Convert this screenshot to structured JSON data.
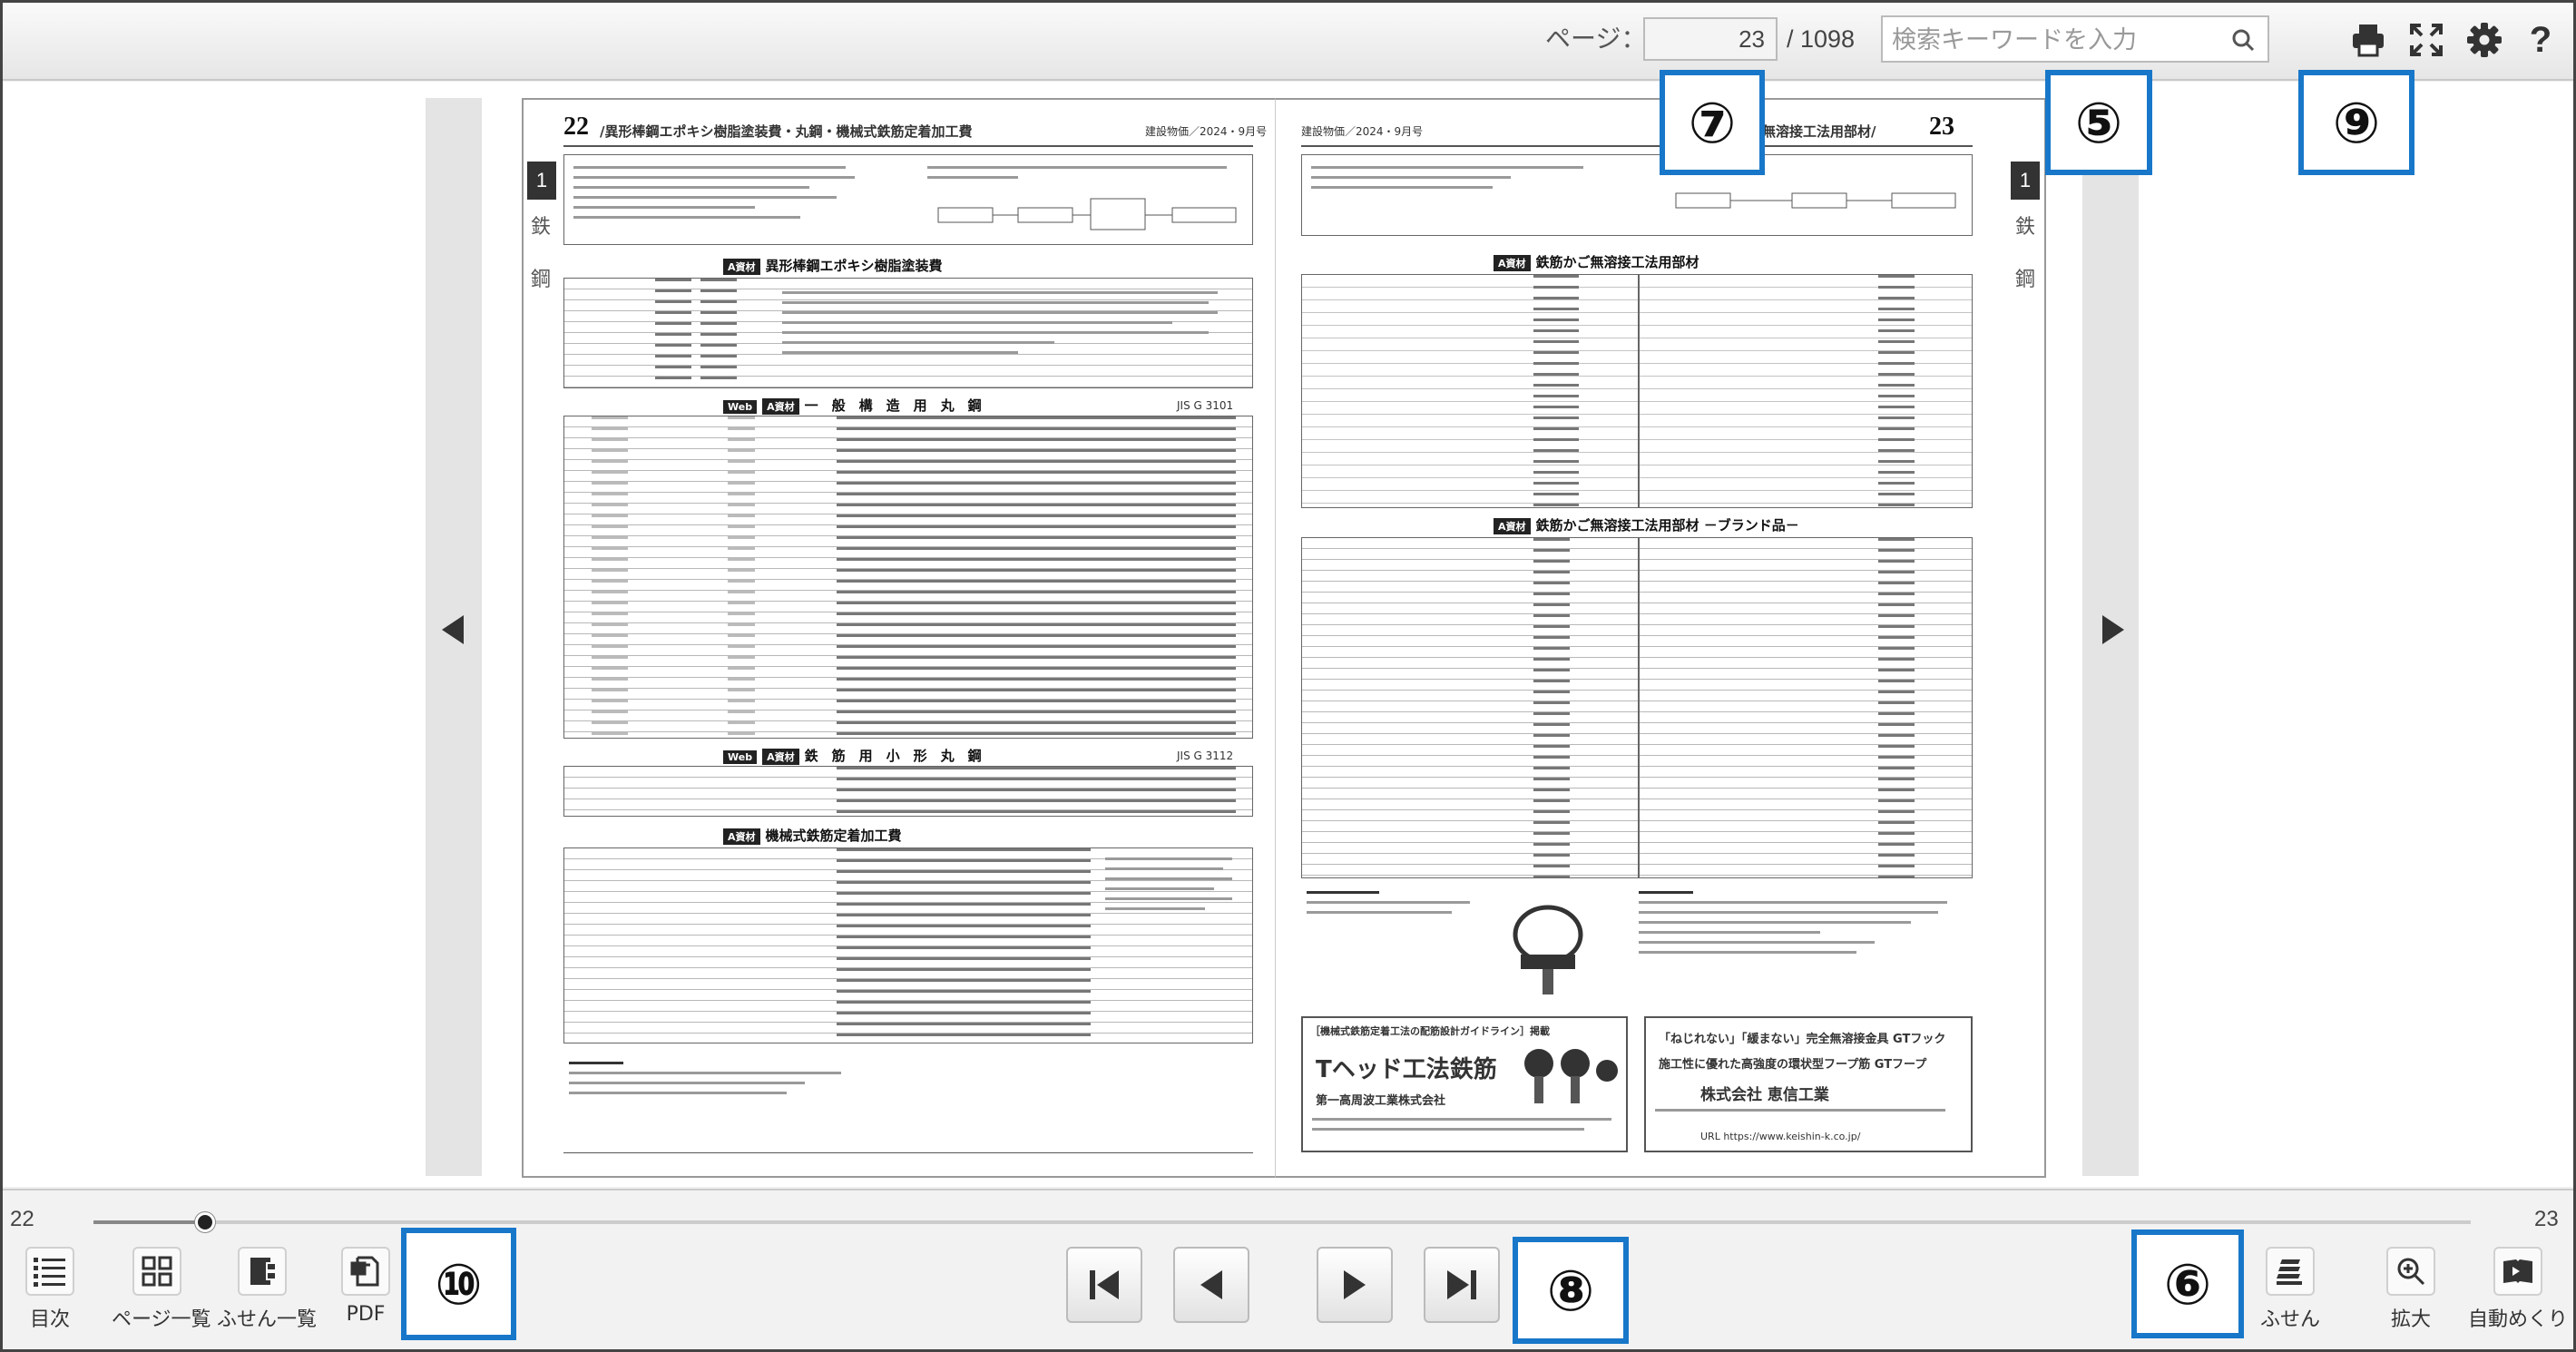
{
  "toolbar": {
    "page_label": "ページ：",
    "current_page": "23",
    "total_pages": "/ 1098",
    "search_placeholder": "検索キーワードを入力",
    "icons": [
      "print-icon",
      "fullscreen-icon",
      "gear-icon",
      "help-icon"
    ]
  },
  "document": {
    "left_page": {
      "page_number": "22",
      "title": "/異形棒鋼エポキシ樹脂塗装費・丸鋼・機械式鉄筋定着加工費",
      "header_right": "建設物価／2024・9月号",
      "section_tab": "1",
      "side_chars": [
        "鉄",
        "鋼"
      ],
      "sections": [
        "異形棒鋼エポキシ樹脂塗装費",
        "一　般　構　造　用　丸　鋼",
        "鉄　筋　用　小　形　丸　鋼",
        "機械式鉄筋定着加工費"
      ],
      "standards": [
        "JIS G 3101",
        "JIS G 3112"
      ],
      "tags": [
        "Web",
        "A資材"
      ]
    },
    "right_page": {
      "page_number": "23",
      "title": "鉄筋かご無溶接工法用部材/",
      "header_left": "建設物価／2024・9月号",
      "section_tab": "1",
      "side_chars": [
        "鉄",
        "鋼"
      ],
      "sections": [
        "鉄筋かご無溶接工法用部材",
        "鉄筋かご無溶接工法用部材 －ブランド品－"
      ],
      "ads": [
        {
          "heading": "［機械式鉄筋定着工法の配筋設計ガイドライン］掲載",
          "name": "Tヘッド工法鉄筋",
          "company": "第一高周波工業株式会社"
        },
        {
          "heading": "「ねじれない」「緩まない」完全無溶接金具 GTフック",
          "name": "施工性に優れた高強度の環状型フープ筋 GTフープ",
          "company": "株式会社 恵信工業",
          "url": "URL https://www.keishin-k.co.jp/"
        }
      ]
    }
  },
  "slider": {
    "min_label": "22",
    "max_label": "23",
    "position": 0.047
  },
  "bottom_tools_left": [
    {
      "label": "目次",
      "icon": "toc-icon"
    },
    {
      "label": "ページ一覧",
      "icon": "grid-icon"
    },
    {
      "label": "ふせん一覧",
      "icon": "sticky-list-icon"
    },
    {
      "label": "PDF",
      "icon": "pdf-icon"
    }
  ],
  "bottom_tools_right": [
    {
      "label": "ふせん",
      "icon": "sticky-note-icon"
    },
    {
      "label": "拡大",
      "icon": "zoom-in-icon"
    },
    {
      "label": "自動めくり",
      "icon": "auto-flip-icon"
    }
  ],
  "nav_buttons": [
    "first-page-icon",
    "prev-page-icon",
    "next-page-icon",
    "last-page-icon"
  ],
  "callouts": {
    "c5": "⑤",
    "c6": "⑥",
    "c7": "⑦",
    "c8": "⑧",
    "c9": "⑨",
    "c10": "⑩"
  },
  "colors": {
    "callout_border": "#1877c9",
    "toolbar_bg": "#ececec"
  }
}
